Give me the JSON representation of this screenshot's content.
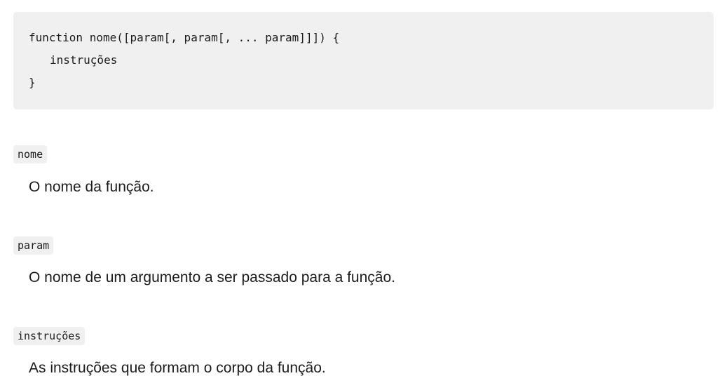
{
  "syntax": {
    "lines": [
      "function nome([param[, param[, ... param]]]) {",
      "instruções",
      "}"
    ]
  },
  "params": [
    {
      "term": "nome",
      "description": "O nome da função."
    },
    {
      "term": "param",
      "description": "O nome de um argumento a ser passado para a função."
    },
    {
      "term": "instruções",
      "description": "As instruções que formam o corpo da função."
    }
  ]
}
